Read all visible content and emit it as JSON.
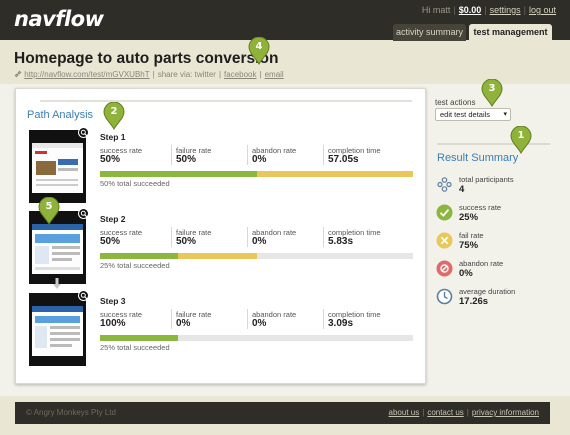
{
  "app": {
    "logo": "navflow"
  },
  "usernav": {
    "greeting": "Hi matt",
    "balance": "$0.00",
    "settings": "settings",
    "logout": "log out"
  },
  "tabs": [
    {
      "label": "activity summary",
      "active": false
    },
    {
      "label": "test management",
      "active": true
    }
  ],
  "page": {
    "title": "Homepage to auto parts conversion",
    "test_url": "http://navflow.com/test/mGVXUBhT",
    "share_label": "share via: twitter",
    "facebook": "facebook",
    "email": "email"
  },
  "path_analysis": {
    "title": "Path Analysis",
    "stat_labels": {
      "success": "success rate",
      "failure": "failure rate",
      "abandon": "abandon rate",
      "completion": "completion time"
    },
    "steps": [
      {
        "name": "Step 1",
        "success": "50%",
        "failure": "50%",
        "abandon": "0%",
        "completion": "57.05s",
        "summary": "50% total succeeded",
        "success_pct": 50,
        "failure_pct": 50
      },
      {
        "name": "Step 2",
        "success": "50%",
        "failure": "50%",
        "abandon": "0%",
        "completion": "5.83s",
        "summary": "25% total succeeded",
        "success_pct": 25,
        "failure_pct": 25
      },
      {
        "name": "Step 3",
        "success": "100%",
        "failure": "0%",
        "abandon": "0%",
        "completion": "3.09s",
        "summary": "25% total succeeded",
        "success_pct": 25,
        "failure_pct": 0
      }
    ]
  },
  "test_actions": {
    "label": "test actions",
    "selected": "edit test details"
  },
  "result_summary": {
    "title": "Result Summary",
    "items": [
      {
        "label": "total participants",
        "value": "4",
        "icon": "participants-icon"
      },
      {
        "label": "success rate",
        "value": "25%",
        "icon": "check-icon"
      },
      {
        "label": "fail rate",
        "value": "75%",
        "icon": "cross-icon"
      },
      {
        "label": "abandon rate",
        "value": "0%",
        "icon": "abandon-icon"
      },
      {
        "label": "average duration",
        "value": "17.26s",
        "icon": "clock-icon"
      }
    ]
  },
  "callouts": [
    "1",
    "2",
    "3",
    "4",
    "5"
  ],
  "footer": {
    "copyright": "© Angry Monkeys Pty Ltd",
    "about": "about us",
    "contact": "contact us",
    "privacy": "privacy information"
  },
  "colors": {
    "success": "#8bb63f",
    "failure": "#e9c75b",
    "accent": "#3b7fb7",
    "header": "#2f2d28",
    "pin": "#8fb33a"
  }
}
